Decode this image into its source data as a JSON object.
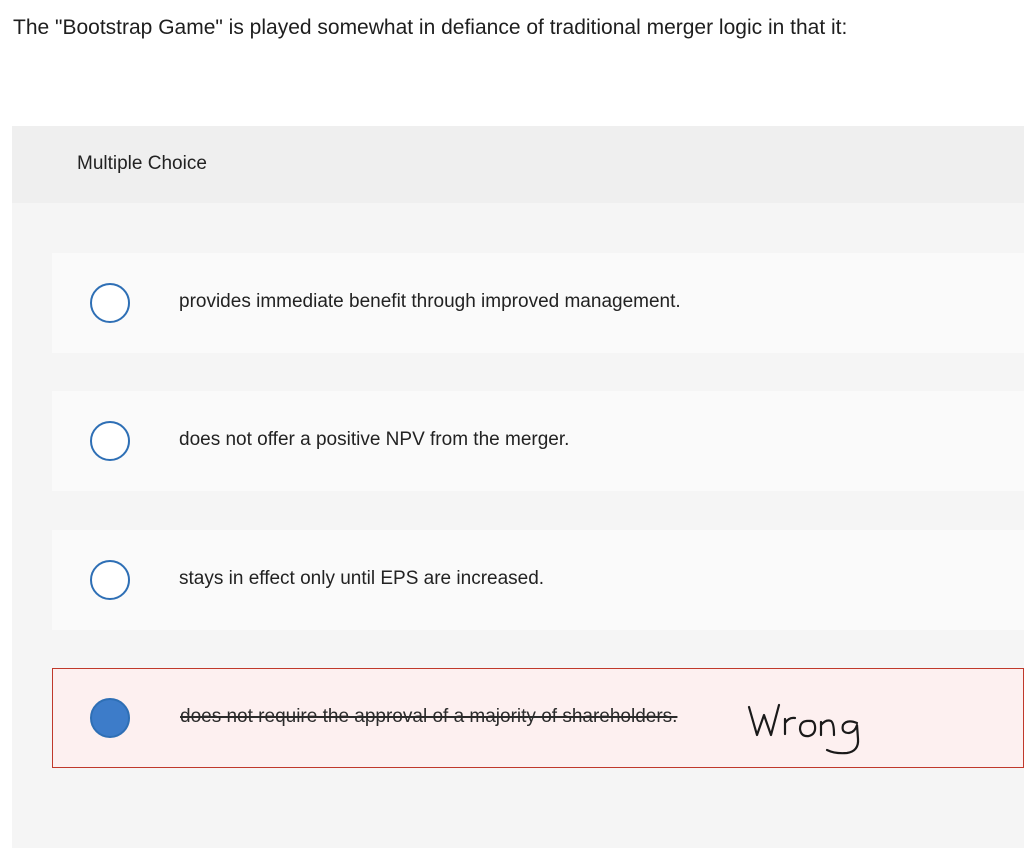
{
  "question": {
    "text": "The \"Bootstrap Game\" is played somewhat in defiance of traditional merger logic in that it:"
  },
  "panel": {
    "header_label": "Multiple Choice"
  },
  "options": [
    {
      "label": "provides immediate benefit through improved management.",
      "selected": false
    },
    {
      "label": "does not offer a positive NPV from the merger.",
      "selected": false
    },
    {
      "label": "stays in effect only until EPS are increased.",
      "selected": false
    },
    {
      "label": "does not require the approval of a majority of shareholders.",
      "selected": true
    }
  ],
  "annotation": {
    "handwritten_text": "Wrong"
  },
  "colors": {
    "radio_accent": "#3d7cc9",
    "wrong_border": "#c0392b",
    "wrong_background": "#fdf0f0"
  }
}
